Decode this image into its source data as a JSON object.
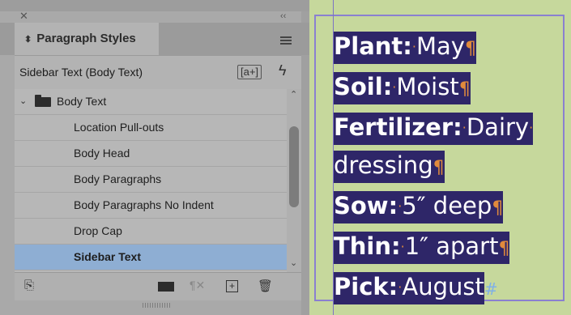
{
  "panel": {
    "title": "Paragraph Styles",
    "current_style": "Sidebar Text (Body Text)",
    "new_override_label": "[a+]",
    "styles": [
      {
        "label": "Body Text",
        "type": "group"
      },
      {
        "label": "Location Pull-outs",
        "type": "style"
      },
      {
        "label": "Body Head",
        "type": "style"
      },
      {
        "label": "Body Paragraphs",
        "type": "style"
      },
      {
        "label": "Body Paragraphs No Indent",
        "type": "style"
      },
      {
        "label": "Drop Cap",
        "type": "style"
      },
      {
        "label": "Sidebar Text",
        "type": "style",
        "selected": true
      }
    ]
  },
  "icons": {
    "close": "close-icon",
    "collapse": "double-chevron-icon",
    "menu": "panel-menu-icon",
    "quick_apply": "lightning-bolt-icon",
    "load": "load-styles-icon",
    "new_group": "folder-icon",
    "clear_overrides": "clear-overrides-icon",
    "new_style": "plus-box-icon",
    "delete": "trash-icon"
  },
  "document": {
    "lines": [
      {
        "label": "Plant:",
        "value": "May",
        "end": "pilcrow"
      },
      {
        "label": "Soil:",
        "value": "Moist",
        "end": "pilcrow"
      },
      {
        "label": "Fertilizer:",
        "value": "Dairy",
        "end": "dot"
      },
      {
        "label": "",
        "value": "dressing",
        "end": "pilcrow"
      },
      {
        "label": "Sow:",
        "value": "5″ deep",
        "end": "pilcrow"
      },
      {
        "label": "Thin:",
        "value": "1″ apart",
        "end": "pilcrow"
      },
      {
        "label": "Pick:",
        "value": "August",
        "end": "hash"
      }
    ]
  },
  "colors": {
    "highlight": "#2e2668",
    "selected_row": "#8eaed3",
    "frame": "#8a80d0",
    "page": "#c6d89c"
  }
}
